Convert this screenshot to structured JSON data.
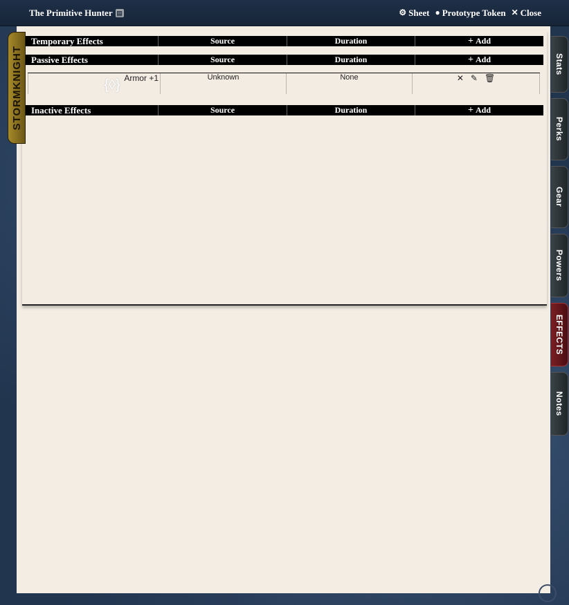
{
  "window": {
    "title": "The Primitive Hunter",
    "controls": [
      {
        "label": "Sheet",
        "icon": "gear-icon",
        "glyph": "⚙"
      },
      {
        "label": "Prototype Token",
        "icon": "user-circle-icon",
        "glyph": "●"
      },
      {
        "label": "Close",
        "icon": "close-icon",
        "glyph": "✕"
      }
    ]
  },
  "faction_tab": {
    "label": "STORMKNIGHT"
  },
  "effects": {
    "temporary": {
      "label": "Temporary Effects",
      "source": "Source",
      "duration": "Duration",
      "add": "Add"
    },
    "passive": {
      "label": "Passive Effects",
      "source": "Source",
      "duration": "Duration",
      "add": "Add"
    },
    "inactive": {
      "label": "Inactive Effects",
      "source": "Source",
      "duration": "Duration",
      "add": "Add"
    },
    "passive_rows": [
      {
        "name": "Armor +1",
        "source": "Unknown",
        "duration": "None",
        "icon": "shield-effect-icon"
      }
    ]
  },
  "side_tabs": [
    {
      "label": "Stats",
      "active": false
    },
    {
      "label": "Perks",
      "active": false
    },
    {
      "label": "Gear",
      "active": false
    },
    {
      "label": "Powers",
      "active": false
    },
    {
      "label": "EFFECTS",
      "active": true
    },
    {
      "label": "Notes",
      "active": false
    }
  ],
  "colors": {
    "header_bg": "#1e2f47",
    "sheet_bg": "#f3ede4",
    "active_tab": "#7a1f24",
    "faction_tab": "#a68a2a"
  }
}
